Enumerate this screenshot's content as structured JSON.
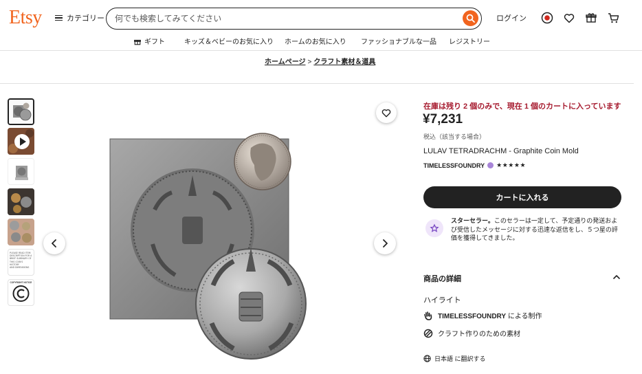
{
  "header": {
    "logo": "Etsy",
    "categories_label": "カテゴリー",
    "search_placeholder": "何でも検索してみてください",
    "signin_label": "ログイン"
  },
  "subnav": {
    "items": [
      "ギフト",
      "キッズ＆ベビーのお気に入り",
      "ホームのお気に入り",
      "ファッショナブルな一品",
      "レジストリー"
    ]
  },
  "breadcrumb": {
    "items": [
      "ホームページ",
      "クラフト素材＆道具"
    ],
    "separator": ">"
  },
  "product": {
    "stock_notice": "在庫は残り 2 個のみで、現在 1 個のカートに入っています",
    "price": "¥7,231",
    "tax_note": "税込（該当する場合）",
    "title": "LULAV TETRADRACHM - Graphite Coin Mold",
    "shop_name": "TIMELESSFOUNDRY",
    "rating_stars": "★★★★★",
    "add_to_cart": "カートに入れる"
  },
  "star_seller": {
    "title": "スターセラー。",
    "description": "このセラーは一定して、予定通りの発送および受信したメッセージに対する迅速な返信をし、５つ星の評価を獲得してきました。"
  },
  "details": {
    "heading": "商品の詳細",
    "highlight_label": "ハイライト",
    "made_by_shop": "TIMELESSFOUNDRY",
    "made_by_suffix": "による制作",
    "material": "クラフト作りのための素材",
    "translate_link": "日本語 に翻訳する"
  },
  "thumbnails": {
    "note_lines": [
      "PLEASE READ ITEM",
      "DESCRIPTION FOR A",
      "BRIEF SUMMARY OF",
      "THIS COIN'S HISTORY",
      "AND DIMENSIONS"
    ],
    "copyright_label": "COPYRIGHT NOTICE"
  },
  "colors": {
    "brand": "#f1641e",
    "stock_red": "#a61a2e",
    "button_dark": "#222222",
    "star_seller_purple": "#a885d8"
  }
}
